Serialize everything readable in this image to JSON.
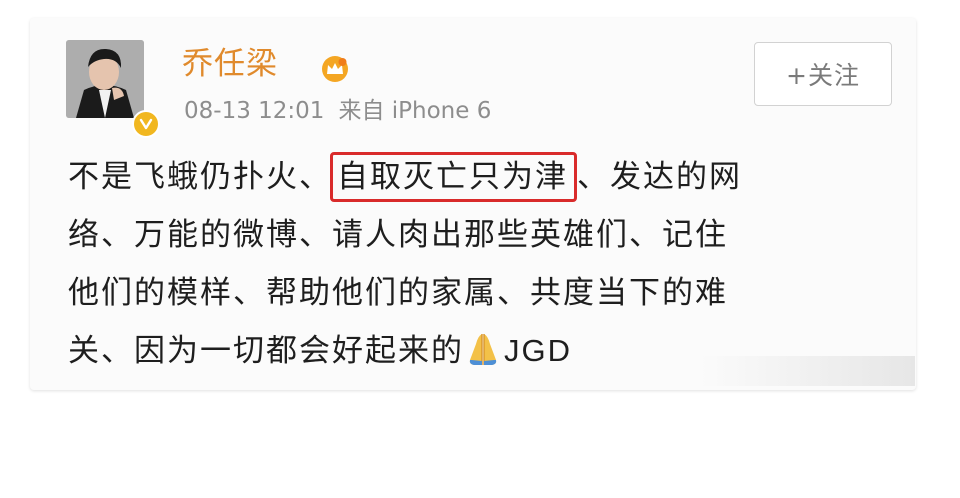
{
  "post": {
    "author": {
      "name": "乔任梁",
      "verified": true,
      "verified_color": "#f1b720",
      "member_icon": "crown-icon"
    },
    "meta": {
      "date": "08-13 12:01",
      "source": "来自 iPhone 6"
    },
    "follow_button": {
      "label": "+关注"
    },
    "content": {
      "line1_before": "不是飞蛾仍扑火、",
      "line1_highlight": "自取灭亡只为津",
      "line1_after": "、发达的网",
      "line2": "络、万能的微博、请人肉出那些英雄们、记住",
      "line3": "他们的模样、帮助他们的家属、共度当下的难",
      "line4_text": "关、因为一切都会好起来的",
      "line4_emoji": "folded-hands-icon",
      "line4_signature": "JGD"
    },
    "colors": {
      "name": "#e08a2c",
      "meta": "#8d8d8d",
      "highlight_border": "#d92b2b",
      "text": "#1e1e1e"
    }
  }
}
